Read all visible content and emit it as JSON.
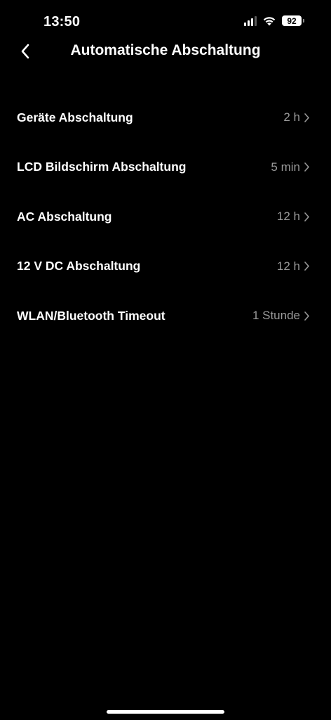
{
  "status_bar": {
    "time": "13:50",
    "battery_level": "92",
    "icons": [
      "signal-icon",
      "wifi-icon",
      "battery-icon"
    ]
  },
  "header": {
    "title": "Automatische Abschaltung",
    "back_icon": "chevron-left-icon"
  },
  "settings": [
    {
      "label": "Geräte Abschaltung",
      "value": "2 h"
    },
    {
      "label": "LCD Bildschirm Abschaltung",
      "value": "5 min"
    },
    {
      "label": "AC Abschaltung",
      "value": "12 h"
    },
    {
      "label": "12 V DC Abschaltung",
      "value": "12 h"
    },
    {
      "label": "WLAN/Bluetooth Timeout",
      "value": "1 Stunde"
    }
  ],
  "colors": {
    "background": "#000000",
    "text_primary": "#ffffff",
    "text_secondary": "#9a9a9a"
  }
}
